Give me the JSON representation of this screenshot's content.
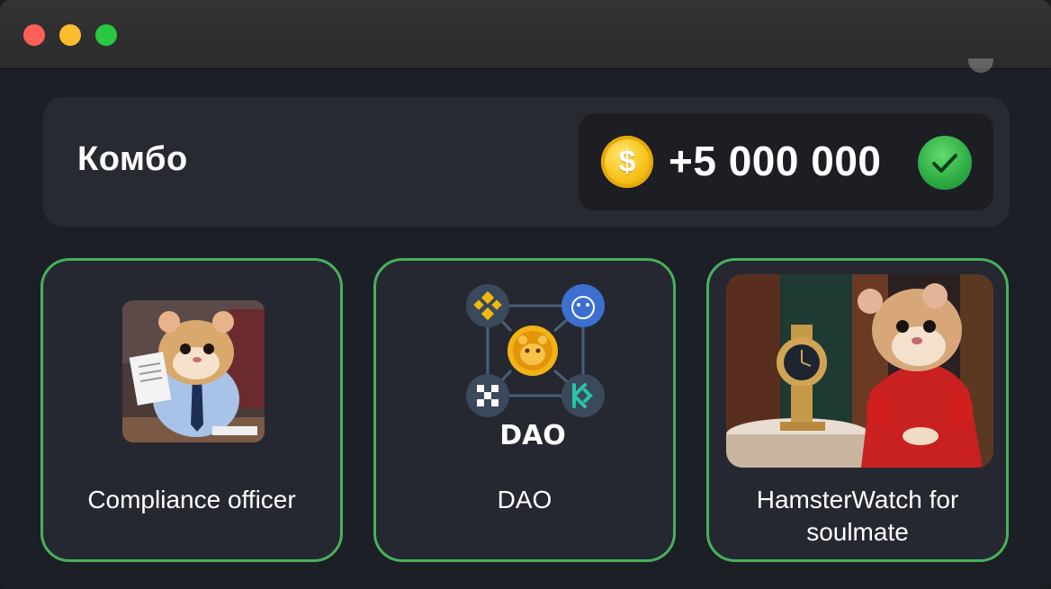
{
  "window": {
    "controls": [
      "close",
      "minimize",
      "zoom"
    ]
  },
  "combo": {
    "title": "Комбо",
    "reward": "+5 000 000",
    "coin_symbol": "$",
    "status_icon": "check-icon",
    "colors": {
      "accent": "#48b05d",
      "coin": "#f7c21a"
    }
  },
  "cards": [
    {
      "label": "Compliance officer",
      "image": "hamster-office-image"
    },
    {
      "label": "DAO",
      "logo_text": "DAO",
      "image": "dao-network-image"
    },
    {
      "label": "HamsterWatch for soulmate",
      "image": "hamster-watch-image"
    }
  ]
}
